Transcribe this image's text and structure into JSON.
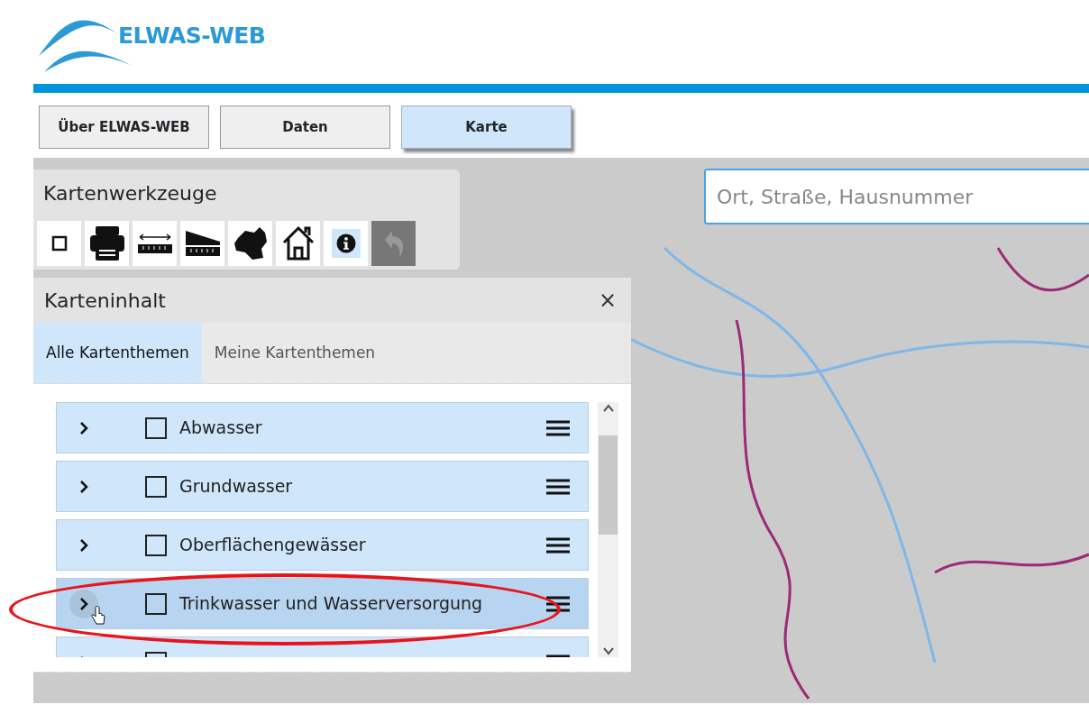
{
  "header": {
    "logo_text": "ELWAS-WEB"
  },
  "nav": [
    {
      "label": "Über ELWAS-WEB",
      "selected": false
    },
    {
      "label": "Daten",
      "selected": false
    },
    {
      "label": "Karte",
      "selected": true
    }
  ],
  "search": {
    "placeholder": "Ort, Straße, Hausnummer"
  },
  "tools_panel": {
    "title": "Kartenwerkzeuge",
    "tools": [
      {
        "kind": "square",
        "selected": false,
        "disabled": false
      },
      {
        "kind": "print",
        "selected": false,
        "disabled": false
      },
      {
        "kind": "ruler",
        "selected": false,
        "disabled": false
      },
      {
        "kind": "area",
        "selected": false,
        "disabled": false
      },
      {
        "kind": "region",
        "selected": false,
        "disabled": false
      },
      {
        "kind": "home",
        "selected": false,
        "disabled": false
      },
      {
        "kind": "info",
        "selected": true,
        "disabled": false
      },
      {
        "kind": "undo",
        "selected": false,
        "disabled": true
      }
    ]
  },
  "content_panel": {
    "title": "Karteninhalt",
    "close": "×",
    "tabs": [
      {
        "label": "Alle Kartenthemen",
        "selected": true
      },
      {
        "label": "Meine Kartenthemen",
        "selected": false
      }
    ],
    "layers": [
      {
        "label": "Abwasser",
        "checked": false,
        "hovered": false,
        "circled": false
      },
      {
        "label": "Grundwasser",
        "checked": false,
        "hovered": false,
        "circled": false
      },
      {
        "label": "Oberflächengewässer",
        "checked": false,
        "hovered": false,
        "circled": false
      },
      {
        "label": "Trinkwasser und Wasserversorgung",
        "checked": false,
        "hovered": true,
        "circled": true
      },
      {
        "checked": false,
        "hovered": false,
        "circled": false
      }
    ]
  }
}
